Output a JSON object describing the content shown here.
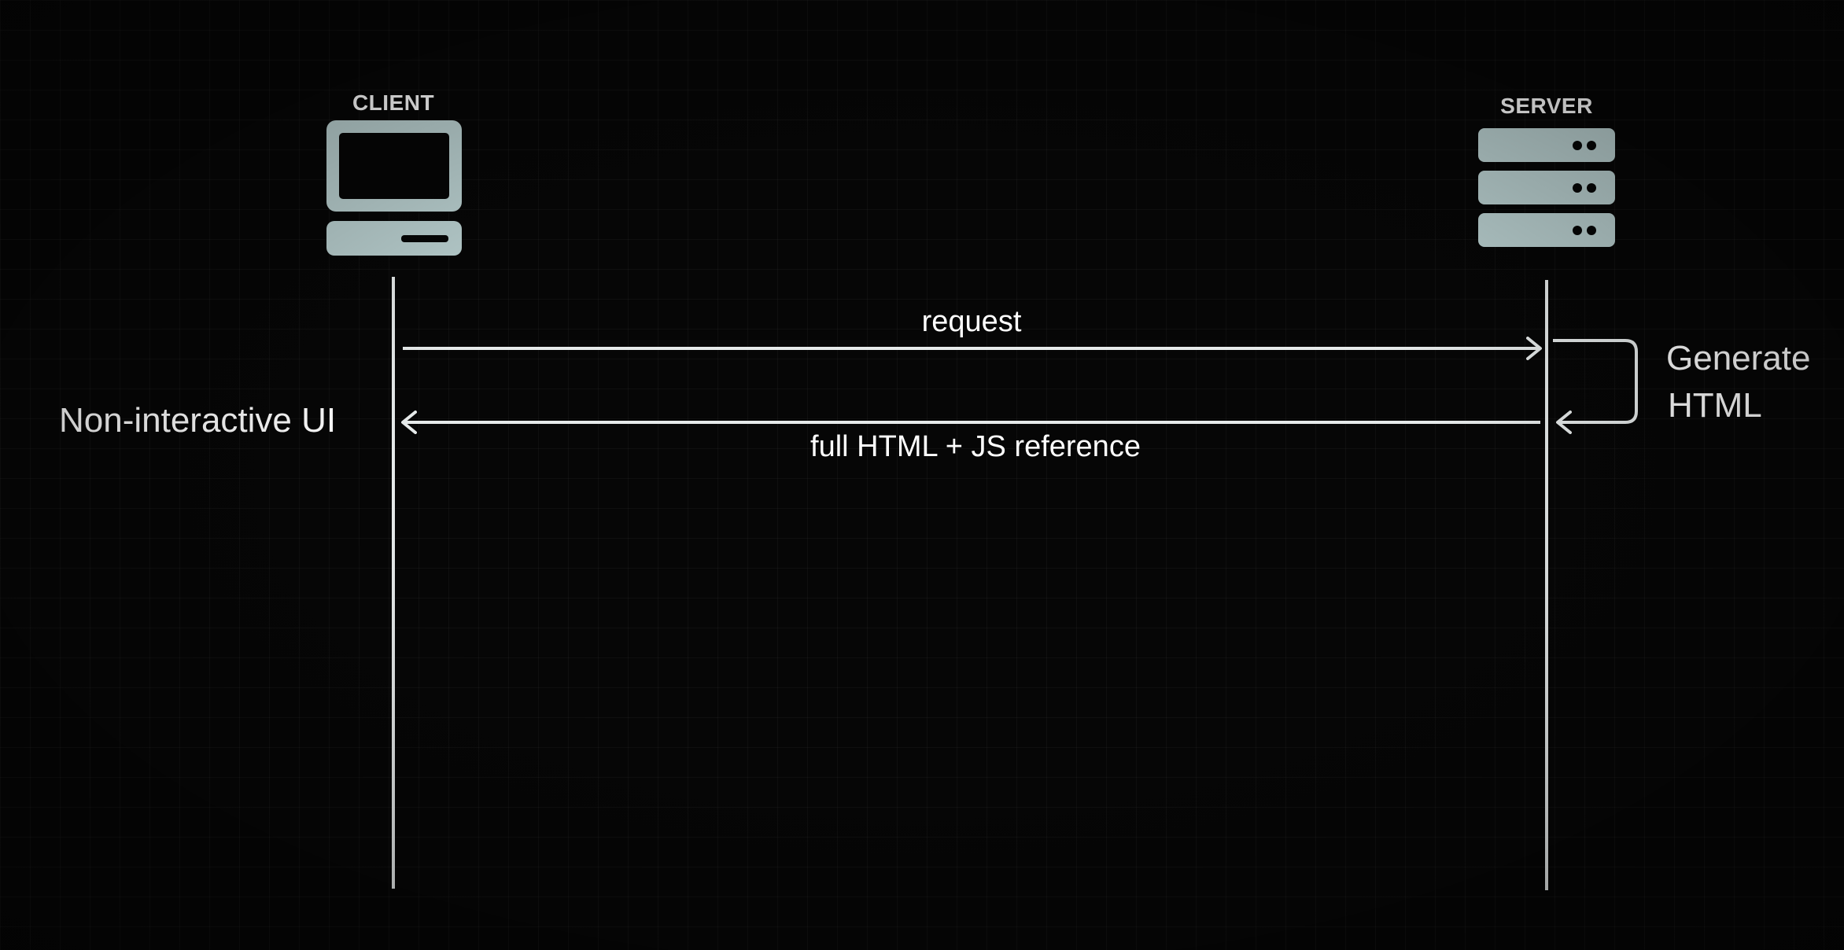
{
  "actors": {
    "client": {
      "label": "CLIENT",
      "icon": "computer-icon"
    },
    "server": {
      "label": "SERVER",
      "icon": "server-rack-icon"
    }
  },
  "messages": [
    {
      "label": "request",
      "from": "client",
      "to": "server"
    },
    {
      "label": "full HTML + JS reference",
      "from": "server",
      "to": "client"
    }
  ],
  "self_action": {
    "lines": [
      "Generate",
      "HTML"
    ]
  },
  "client_result": "Non-interactive UI",
  "colors": {
    "background": "#060606",
    "line": "#e6eaea",
    "icon": "#b9cfcf",
    "text": "#ffffff"
  }
}
